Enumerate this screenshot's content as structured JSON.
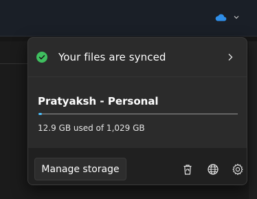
{
  "status": {
    "text": "Your files are synced",
    "icon": "check-circle-icon",
    "color": "#3fbf5f"
  },
  "account": {
    "name": "Pratyaksh - Personal",
    "usage_text": "12.9 GB used of 1,029 GB",
    "used_fraction": 0.0125,
    "accent": "#4cc2ff"
  },
  "footer": {
    "manage_label": "Manage storage",
    "icons": [
      "recycle-bin-icon",
      "globe-icon",
      "settings-gear-icon"
    ]
  },
  "taskbar": {
    "icons": [
      "onedrive-cloud-icon",
      "chevron-down-icon"
    ]
  }
}
